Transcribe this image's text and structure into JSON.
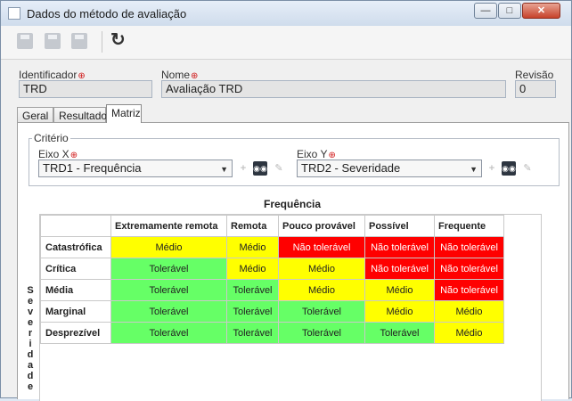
{
  "window": {
    "title": "Dados do método de avaliação",
    "controls": {
      "minimize": "—",
      "maximize": "□",
      "close": "✕"
    }
  },
  "toolbar": {
    "icons": [
      "save-new-icon",
      "save-icon",
      "save-close-icon",
      "refresh-icon"
    ]
  },
  "form": {
    "identificador_label": "Identificador",
    "identificador_value": "TRD",
    "nome_label": "Nome",
    "nome_value": "Avaliação TRD",
    "revisao_label": "Revisão",
    "revisao_value": "0"
  },
  "tabs": [
    {
      "label": "Geral",
      "active": false
    },
    {
      "label": "Resultado",
      "active": false
    },
    {
      "label": "Matriz",
      "active": true
    }
  ],
  "criteria": {
    "legend": "Critério",
    "eixo_x_label": "Eixo X",
    "eixo_x_value": "TRD1 - Frequência",
    "eixo_y_label": "Eixo Y",
    "eixo_y_value": "TRD2 - Severidade"
  },
  "matrix": {
    "x_title": "Frequência",
    "y_title": "Severidade",
    "columns": [
      "Extremamente remota",
      "Remota",
      "Pouco provável",
      "Possível",
      "Frequente"
    ],
    "rows": [
      {
        "label": "Catastrófica",
        "cells": [
          "Médio",
          "Médio",
          "Não tolerável",
          "Não tolerável",
          "Não tolerável"
        ]
      },
      {
        "label": "Crítica",
        "cells": [
          "Tolerável",
          "Médio",
          "Médio",
          "Não tolerável",
          "Não tolerável"
        ]
      },
      {
        "label": "Média",
        "cells": [
          "Tolerável",
          "Tolerável",
          "Médio",
          "Médio",
          "Não tolerável"
        ]
      },
      {
        "label": "Marginal",
        "cells": [
          "Tolerável",
          "Tolerável",
          "Tolerável",
          "Médio",
          "Médio"
        ]
      },
      {
        "label": "Desprezível",
        "cells": [
          "Tolerável",
          "Tolerável",
          "Tolerável",
          "Tolerável",
          "Médio"
        ]
      }
    ],
    "level_colors": {
      "Médio": "#ffff00",
      "Tolerável": "#66ff66",
      "Não tolerável": "#ff0000"
    }
  }
}
